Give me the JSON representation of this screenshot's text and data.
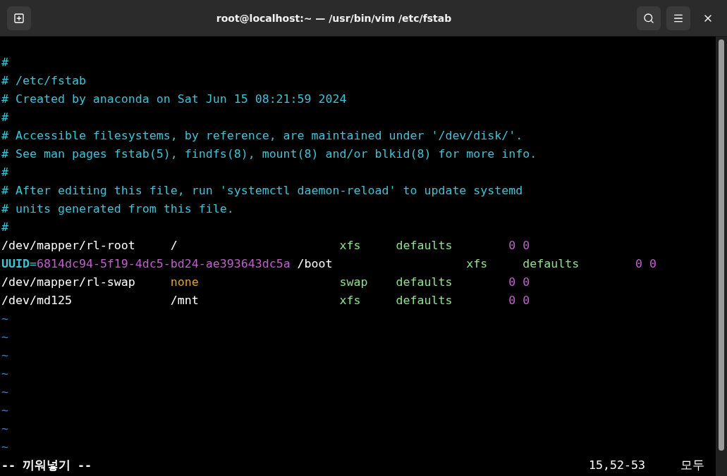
{
  "window": {
    "title": "root@localhost:~ — /usr/bin/vim /etc/fstab"
  },
  "lines": [
    {
      "kind": "blank"
    },
    {
      "kind": "comment",
      "text": "#"
    },
    {
      "kind": "comment",
      "text": "# /etc/fstab"
    },
    {
      "kind": "comment",
      "text": "# Created by anaconda on Sat Jun 15 08:21:59 2024"
    },
    {
      "kind": "comment",
      "text": "#"
    },
    {
      "kind": "comment",
      "text": "# Accessible filesystems, by reference, are maintained under '/dev/disk/'."
    },
    {
      "kind": "comment",
      "text": "# See man pages fstab(5), findfs(8), mount(8) and/or blkid(8) for more info."
    },
    {
      "kind": "comment",
      "text": "#"
    },
    {
      "kind": "comment",
      "text": "# After editing this file, run 'systemctl daemon-reload' to update systemd"
    },
    {
      "kind": "comment",
      "text": "# units generated from this file."
    },
    {
      "kind": "comment",
      "text": "#"
    },
    {
      "kind": "entry",
      "fields": [
        {
          "parts": [
            {
              "text": "/dev/mapper/rl-root",
              "kind": "device"
            }
          ]
        },
        {
          "parts": [
            {
              "text": "/",
              "kind": "device"
            }
          ]
        },
        {
          "parts": [
            {
              "text": "xfs",
              "kind": "type"
            }
          ]
        },
        {
          "parts": [
            {
              "text": "defaults",
              "kind": "type"
            }
          ]
        },
        {
          "parts": [
            {
              "text": "0 0",
              "kind": "number"
            }
          ]
        }
      ]
    },
    {
      "kind": "entry",
      "fields": [
        {
          "parts": [
            {
              "text": "UUID",
              "kind": "keyword"
            },
            {
              "text": "=",
              "kind": "operator"
            },
            {
              "text": "6814dc94-5f19-4dc5-bd24-ae393643dc5a",
              "kind": "number"
            }
          ]
        },
        {
          "parts": [
            {
              "text": "/boot",
              "kind": "device"
            }
          ]
        },
        {
          "parts": [
            {
              "text": "xfs",
              "kind": "type"
            }
          ]
        },
        {
          "parts": [
            {
              "text": "defaults",
              "kind": "type"
            }
          ]
        },
        {
          "parts": [
            {
              "text": "0 0",
              "kind": "number"
            }
          ]
        }
      ]
    },
    {
      "kind": "entry",
      "fields": [
        {
          "parts": [
            {
              "text": "/dev/mapper/rl-swap",
              "kind": "device"
            }
          ]
        },
        {
          "parts": [
            {
              "text": "none",
              "kind": "special"
            }
          ]
        },
        {
          "parts": [
            {
              "text": "swap",
              "kind": "type"
            }
          ]
        },
        {
          "parts": [
            {
              "text": "defaults",
              "kind": "type"
            }
          ]
        },
        {
          "parts": [
            {
              "text": "0 0",
              "kind": "number"
            }
          ]
        }
      ]
    },
    {
      "kind": "entry",
      "fields": [
        {
          "parts": [
            {
              "text": "/dev/md125",
              "kind": "device"
            }
          ]
        },
        {
          "parts": [
            {
              "text": "/mnt",
              "kind": "device"
            }
          ]
        },
        {
          "parts": [
            {
              "text": "xfs",
              "kind": "type"
            }
          ]
        },
        {
          "parts": [
            {
              "text": "defaults",
              "kind": "type"
            }
          ]
        },
        {
          "parts": [
            {
              "text": "0 0",
              "kind": "number"
            }
          ]
        }
      ]
    },
    {
      "kind": "tilde",
      "text": "~"
    },
    {
      "kind": "tilde",
      "text": "~"
    },
    {
      "kind": "tilde",
      "text": "~"
    },
    {
      "kind": "tilde",
      "text": "~"
    },
    {
      "kind": "tilde",
      "text": "~"
    },
    {
      "kind": "tilde",
      "text": "~"
    },
    {
      "kind": "tilde",
      "text": "~"
    },
    {
      "kind": "tilde",
      "text": "~"
    }
  ],
  "status_bar": {
    "mode": "-- 끼워넣기 --",
    "position": "15,52-53",
    "scroll": "모두"
  }
}
